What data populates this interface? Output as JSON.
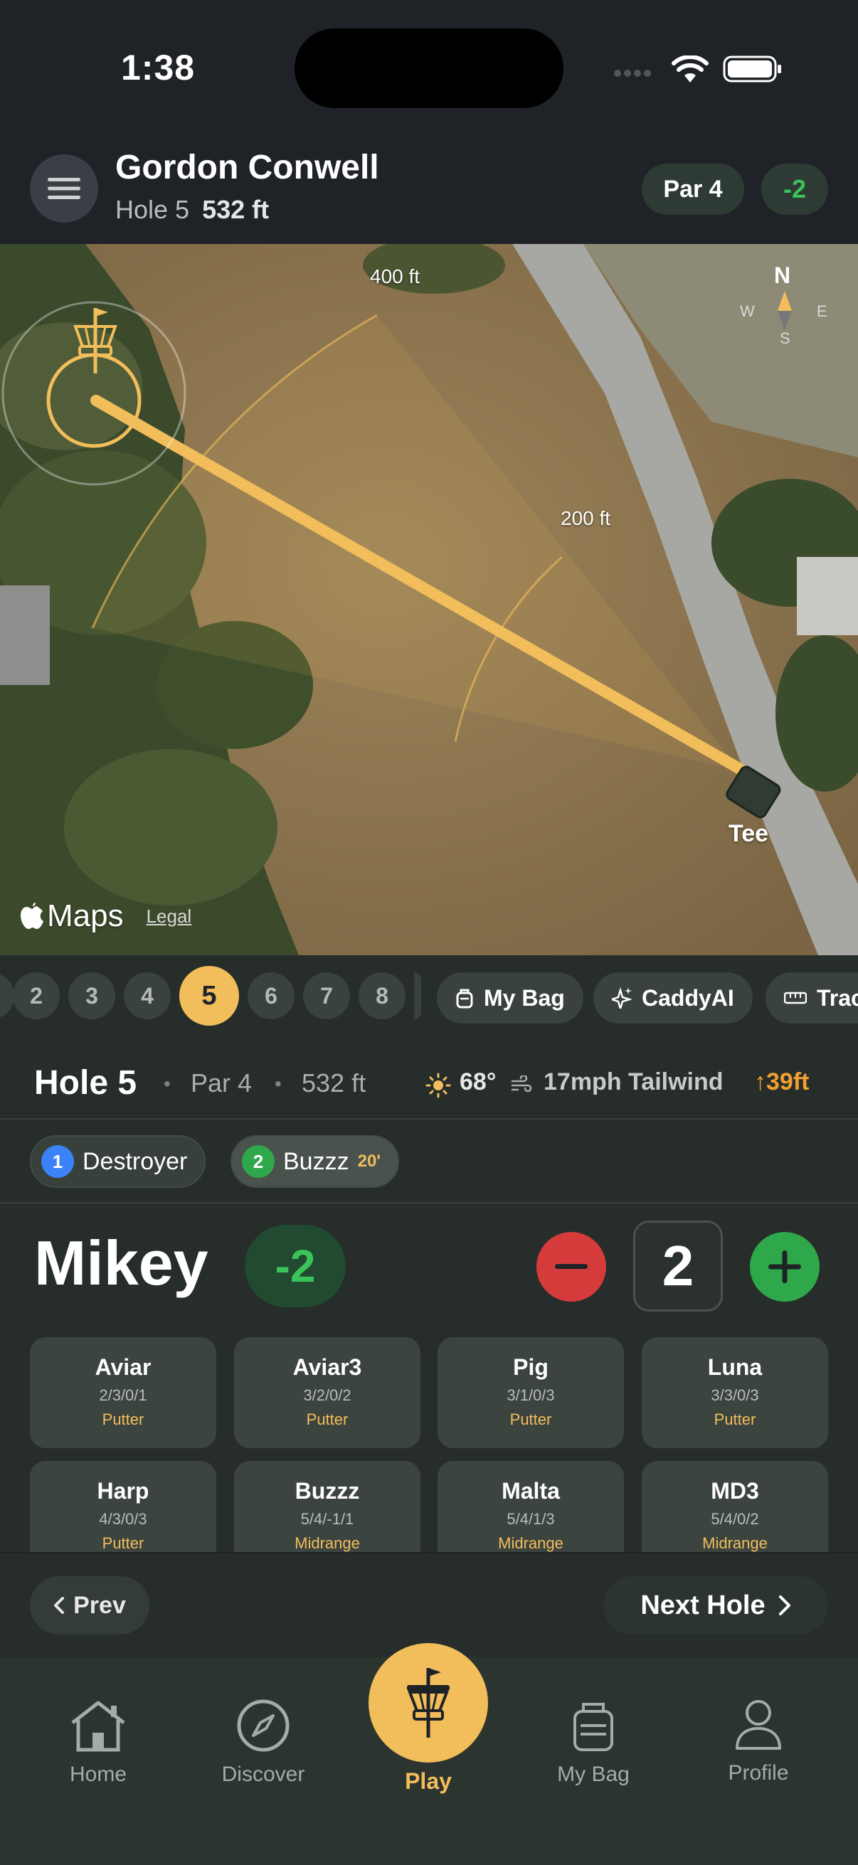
{
  "status": {
    "time": "1:38"
  },
  "header": {
    "course_name": "Gordon Conwell",
    "hole_label": "Hole 5",
    "distance": "532 ft",
    "par": "Par 4",
    "score": "-2"
  },
  "map": {
    "compass": {
      "n": "N",
      "e": "E",
      "s": "S",
      "w": "W"
    },
    "label_400": "400 ft",
    "label_200": "200 ft",
    "tee_label": "Tee",
    "attribution": "Maps",
    "legal": "Legal"
  },
  "holes": [
    "2",
    "3",
    "4",
    "5",
    "6",
    "7",
    "8"
  ],
  "active_hole": "5",
  "quick_actions": [
    "My Bag",
    "CaddyAI",
    "Trac"
  ],
  "hole_info": {
    "title": "Hole 5",
    "par": "Par 4",
    "distance": "532 ft",
    "temp": "68°",
    "wind": "17mph Tailwind",
    "elevation": "↑39ft"
  },
  "throws": [
    {
      "num": "1",
      "disc": "Destroyer",
      "extra": "",
      "color": "#3b82f6"
    },
    {
      "num": "2",
      "disc": "Buzzz",
      "extra": "20'",
      "color": "#2ea84a"
    }
  ],
  "player": {
    "name": "Mikey",
    "score": "-2",
    "strokes": "2"
  },
  "discs": [
    {
      "name": "Aviar",
      "flight": "2/3/0/1",
      "type": "Putter"
    },
    {
      "name": "Aviar3",
      "flight": "3/2/0/2",
      "type": "Putter"
    },
    {
      "name": "Pig",
      "flight": "3/1/0/3",
      "type": "Putter"
    },
    {
      "name": "Luna",
      "flight": "3/3/0/3",
      "type": "Putter"
    },
    {
      "name": "Harp",
      "flight": "4/3/0/3",
      "type": "Putter"
    },
    {
      "name": "Buzzz",
      "flight": "5/4/-1/1",
      "type": "Midrange"
    },
    {
      "name": "Malta",
      "flight": "5/4/1/3",
      "type": "Midrange"
    },
    {
      "name": "MD3",
      "flight": "5/4/0/2",
      "type": "Midrange"
    }
  ],
  "nav": {
    "prev": "Prev",
    "next": "Next Hole"
  },
  "tabs": {
    "home": "Home",
    "discover": "Discover",
    "play": "Play",
    "my_bag": "My Bag",
    "profile": "Profile"
  },
  "colors": {
    "accent": "#f2bd5b",
    "positive": "#3cc25a",
    "negative": "#d63b3b",
    "elevation": "#f0a030"
  }
}
